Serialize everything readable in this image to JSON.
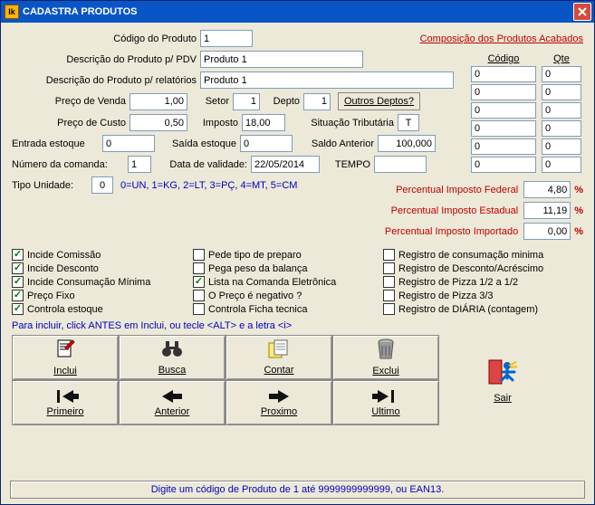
{
  "window": {
    "title": "CADASTRA PRODUTOS"
  },
  "link_composicao": "Composição dos Produtos Acabados",
  "labels": {
    "codigo": "Código do Produto",
    "desc_pdv": "Descrição do Produto p/ PDV",
    "desc_rel": "Descrição do Produto p/ relatórios",
    "preco_venda": "Preço de Venda",
    "setor": "Setor",
    "depto": "Depto",
    "outros_deptos": "Outros Deptos?",
    "preco_custo": "Preço de Custo",
    "imposto": "Imposto",
    "sit_trib": "Situação Tributária",
    "entrada_estoque": "Entrada estoque",
    "saida_estoque": "Saída estoque",
    "saldo_ant": "Saldo Anterior",
    "num_comanda": "Número da comanda:",
    "data_val": "Data de validade:",
    "tempo": "TEMPO",
    "tipo_unidade": "Tipo Unidade:",
    "tipo_legend": "0=UN, 1=KG, 2=LT, 3=PÇ, 4=MT, 5=CM",
    "pct_fed": "Percentual Imposto Federal",
    "pct_est": "Percentual Imposto Estadual",
    "pct_imp": "Percentual Imposto Importado"
  },
  "values": {
    "codigo": "1",
    "desc_pdv": "Produto 1",
    "desc_rel": "Produto 1",
    "preco_venda": "1,00",
    "setor": "1",
    "depto": "1",
    "preco_custo": "0,50",
    "imposto": "18,00",
    "sit_trib": "T",
    "entrada_estoque": "0",
    "saida_estoque": "0",
    "saldo_ant": "100,000",
    "num_comanda": "1",
    "data_val": "22/05/2014",
    "tempo": "",
    "tipo_unidade": "0",
    "pct_fed": "4,80",
    "pct_est": "11,19",
    "pct_imp": "0,00"
  },
  "comp": {
    "head_codigo": "Código",
    "head_qte": "Qte",
    "rows": [
      {
        "codigo": "0",
        "qte": "0"
      },
      {
        "codigo": "0",
        "qte": "0"
      },
      {
        "codigo": "0",
        "qte": "0"
      },
      {
        "codigo": "0",
        "qte": "0"
      },
      {
        "codigo": "0",
        "qte": "0"
      },
      {
        "codigo": "0",
        "qte": "0"
      }
    ]
  },
  "checks": {
    "col1": [
      {
        "label": "Incide Comissão",
        "checked": true
      },
      {
        "label": "Incide Desconto",
        "checked": true
      },
      {
        "label": "Incide Consumação Mínima",
        "checked": true
      },
      {
        "label": "Preço Fixo",
        "checked": true
      },
      {
        "label": "Controla estoque",
        "checked": true
      }
    ],
    "col2": [
      {
        "label": "Pede tipo de preparo",
        "checked": false
      },
      {
        "label": "Pega peso da balança",
        "checked": false
      },
      {
        "label": "Lista na Comanda Eletrônica",
        "checked": true
      },
      {
        "label": "O Preço é negativo ?",
        "checked": false
      },
      {
        "label": "Controla Ficha tecnica",
        "checked": false
      }
    ],
    "col3": [
      {
        "label": "Registro de consumação minima",
        "checked": false
      },
      {
        "label": "Registro de Desconto/Acréscimo",
        "checked": false
      },
      {
        "label": "Registro de Pizza 1/2 a 1/2",
        "checked": false
      },
      {
        "label": "Registro de Pizza 3/3",
        "checked": false
      },
      {
        "label": "Registro de DIÁRIA (contagem)",
        "checked": false
      }
    ]
  },
  "note": "Para incluir, click ANTES em Inclui, ou tecle <ALT> e a letra <i>",
  "toolbar": {
    "inclui": "Inclui",
    "busca": "Busca",
    "contar": "Contar",
    "exclui": "Exclui",
    "primeiro": "Primeiro",
    "anterior": "Anterior",
    "proximo": "Proximo",
    "ultimo": "Ultimo",
    "sair": "Sair"
  },
  "status": "Digite um código de Produto de 1 até 9999999999999, ou EAN13."
}
